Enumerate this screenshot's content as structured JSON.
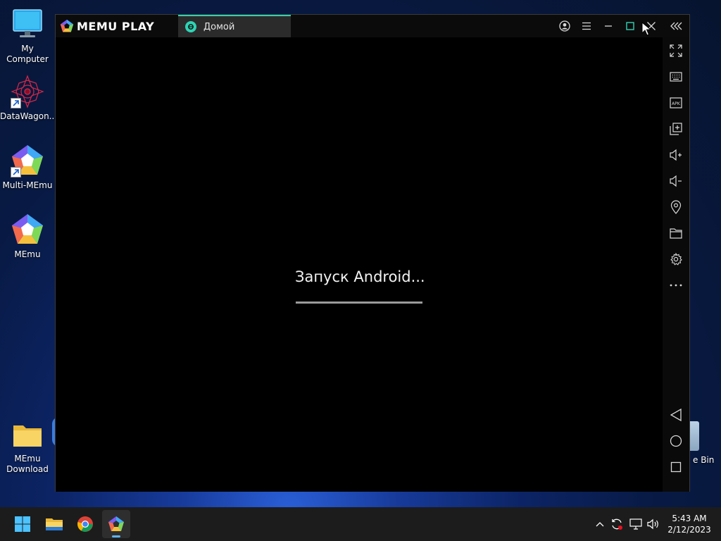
{
  "desktop": {
    "icons": [
      {
        "label": "My Computer",
        "icon": "monitor-icon"
      },
      {
        "label": "DataWagon...",
        "icon": "datawagon-icon"
      },
      {
        "label": "Multi-MEmu",
        "icon": "multi-memu-icon"
      },
      {
        "label": "MEmu",
        "icon": "memu-icon"
      },
      {
        "label": "MEmu Download",
        "icon": "folder-icon"
      }
    ],
    "recycle_bin_label": "e Bin"
  },
  "emulator": {
    "brand": "MEMU PLAY",
    "tab": {
      "label": "Домой",
      "accent": "#2fd3b4"
    },
    "titlebar_buttons": [
      "account-icon",
      "menu-icon",
      "minimize-icon",
      "maximize-icon",
      "close-icon",
      "collapse-sidebar-icon"
    ],
    "status_text": "Запуск Android...",
    "boot_progress": 1.0,
    "sidebar_tools": [
      "fullscreen-icon",
      "keyboard-mapping-icon",
      "apk-install-icon",
      "multi-window-icon",
      "volume-up-icon",
      "volume-down-icon",
      "location-icon",
      "shared-folder-icon",
      "settings-icon",
      "more-icon"
    ],
    "nav_buttons": [
      "back-icon",
      "home-icon",
      "recents-icon"
    ]
  },
  "taskbar": {
    "apps": [
      "windows-start-icon",
      "file-explorer-icon",
      "chrome-icon",
      "memu-taskbar-icon"
    ],
    "active_app": "memu-taskbar-icon",
    "tray": [
      "show-hidden-icons-icon",
      "sync-icon",
      "network-icon",
      "volume-icon"
    ],
    "time": "5:43 AM",
    "date": "2/12/2023"
  },
  "colors": {
    "accent_teal": "#2fd3b4",
    "taskbar_bg": "#1c1c1c",
    "active_indicator": "#5fb2f2"
  }
}
